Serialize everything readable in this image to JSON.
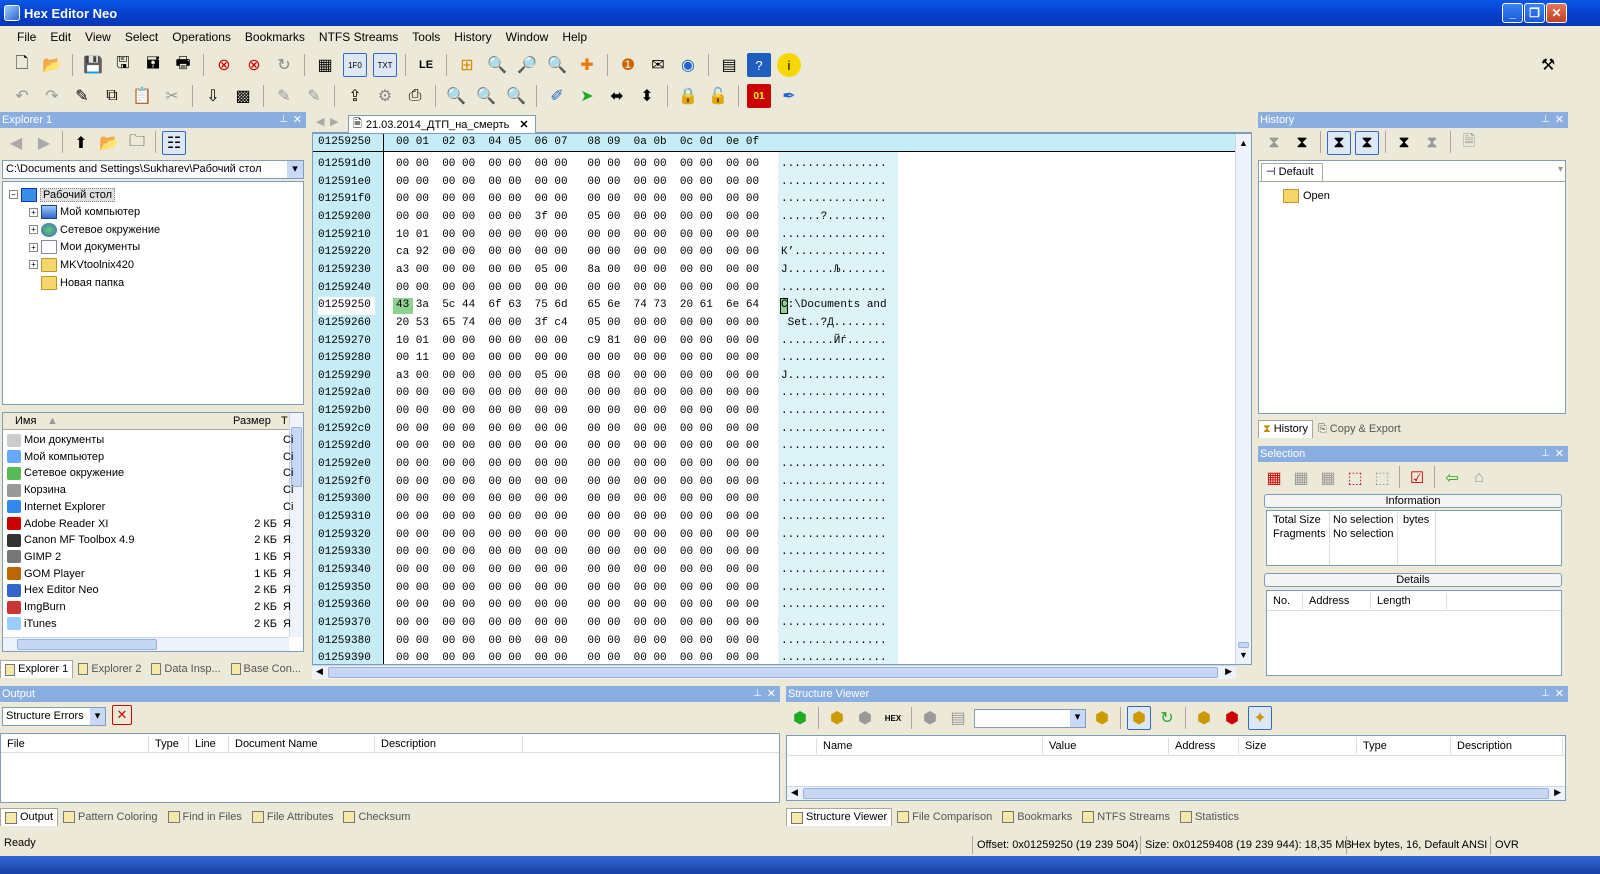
{
  "app": {
    "title": "Hex Editor Neo"
  },
  "menu": [
    "File",
    "Edit",
    "View",
    "Select",
    "Operations",
    "Bookmarks",
    "NTFS Streams",
    "Tools",
    "History",
    "Window",
    "Help"
  ],
  "explorer": {
    "title": "Explorer 1",
    "path": "C:\\Documents and Settings\\Sukharev\\Рабочий стол",
    "tree": [
      {
        "label": "Рабочий стол",
        "icon": "desktop-icon",
        "level": 0,
        "expander": "−",
        "selected": true
      },
      {
        "label": "Мой компьютер",
        "icon": "computer-icon",
        "level": 1,
        "expander": "+"
      },
      {
        "label": "Сетевое окружение",
        "icon": "network-icon",
        "level": 1,
        "expander": "+"
      },
      {
        "label": "Мои документы",
        "icon": "documents-icon",
        "level": 1,
        "expander": "+"
      },
      {
        "label": "MKVtoolnix420",
        "icon": "folder-icon",
        "level": 1,
        "expander": "+"
      },
      {
        "label": "Новая папка",
        "icon": "folder-icon",
        "level": 1,
        "expander": ""
      }
    ],
    "list_headers": {
      "name": "Имя",
      "size": "Размер",
      "type": "Т"
    },
    "list": [
      {
        "name": "Мои документы",
        "size": "",
        "type": "Сі"
      },
      {
        "name": "Мой компьютер",
        "size": "",
        "type": "Сі"
      },
      {
        "name": "Сетевое окружение",
        "size": "",
        "type": "Сі"
      },
      {
        "name": "Корзина",
        "size": "",
        "type": "Сі"
      },
      {
        "name": "Internet Explorer",
        "size": "",
        "type": "Сі"
      },
      {
        "name": "Adobe Reader XI",
        "size": "2 КБ",
        "type": "Я"
      },
      {
        "name": "Canon MF Toolbox 4.9",
        "size": "2 КБ",
        "type": "Я"
      },
      {
        "name": "GIMP 2",
        "size": "1 КБ",
        "type": "Я"
      },
      {
        "name": "GOM Player",
        "size": "1 КБ",
        "type": "Я"
      },
      {
        "name": "Hex Editor Neo",
        "size": "2 КБ",
        "type": "Я"
      },
      {
        "name": "ImgBurn",
        "size": "2 КБ",
        "type": "Я"
      },
      {
        "name": "iTunes",
        "size": "2 КБ",
        "type": "Я"
      }
    ],
    "tabs": [
      "Explorer 1",
      "Explorer 2",
      "Data Insp...",
      "Base Con..."
    ]
  },
  "editor": {
    "tab": "21.03.2014_ДТП_на_смерть",
    "header_offset": "01259250",
    "header_cols": "00 01  02 03  04 05  06 07   08 09  0a 0b  0c 0d  0e 0f",
    "rows": [
      {
        "off": "012591d0",
        "hex": "00 00  00 00  00 00  00 00   00 00  00 00  00 00  00 00",
        "asc": "................"
      },
      {
        "off": "012591e0",
        "hex": "00 00  00 00  00 00  00 00   00 00  00 00  00 00  00 00",
        "asc": "................"
      },
      {
        "off": "012591f0",
        "hex": "00 00  00 00  00 00  00 00   00 00  00 00  00 00  00 00",
        "asc": "................"
      },
      {
        "off": "01259200",
        "hex": "00 00  00 00  00 00  3f 00   05 00  00 00  00 00  00 00",
        "asc": "......?........."
      },
      {
        "off": "01259210",
        "hex": "10 01  00 00  00 00  00 00   00 00  00 00  00 00  00 00",
        "asc": "................"
      },
      {
        "off": "01259220",
        "hex": "ca 92  00 00  00 00  00 00   00 00  00 00  00 00  00 00",
        "asc": "К’.............."
      },
      {
        "off": "01259230",
        "hex": "a3 00  00 00  00 00  05 00   8a 00  00 00  00 00  00 00",
        "asc": "Ј.......Љ......."
      },
      {
        "off": "01259240",
        "hex": "00 00  00 00  00 00  00 00   00 00  00 00  00 00  00 00",
        "asc": "................"
      },
      {
        "off": "01259250",
        "hex": "43 3a  5c 44  6f 63  75 6d   65 6e  74 73  20 61  6e 64",
        "asc": "C:\\Documents and",
        "cursor": true
      },
      {
        "off": "01259260",
        "hex": "20 53  65 74  00 00  3f c4   05 00  00 00  00 00  00 00",
        "asc": " Set..?Д........"
      },
      {
        "off": "01259270",
        "hex": "10 01  00 00  00 00  00 00   c9 81  00 00  00 00  00 00",
        "asc": "........Йѓ......"
      },
      {
        "off": "01259280",
        "hex": "00 11  00 00  00 00  00 00   00 00  00 00  00 00  00 00",
        "asc": "................"
      },
      {
        "off": "01259290",
        "hex": "a3 00  00 00  00 00  05 00   08 00  00 00  00 00  00 00",
        "asc": "Ј..............."
      },
      {
        "off": "012592a0",
        "hex": "00 00  00 00  00 00  00 00   00 00  00 00  00 00  00 00",
        "asc": "................"
      },
      {
        "off": "012592b0",
        "hex": "00 00  00 00  00 00  00 00   00 00  00 00  00 00  00 00",
        "asc": "................"
      },
      {
        "off": "012592c0",
        "hex": "00 00  00 00  00 00  00 00   00 00  00 00  00 00  00 00",
        "asc": "................"
      },
      {
        "off": "012592d0",
        "hex": "00 00  00 00  00 00  00 00   00 00  00 00  00 00  00 00",
        "asc": "................"
      },
      {
        "off": "012592e0",
        "hex": "00 00  00 00  00 00  00 00   00 00  00 00  00 00  00 00",
        "asc": "................"
      },
      {
        "off": "012592f0",
        "hex": "00 00  00 00  00 00  00 00   00 00  00 00  00 00  00 00",
        "asc": "................"
      },
      {
        "off": "01259300",
        "hex": "00 00  00 00  00 00  00 00   00 00  00 00  00 00  00 00",
        "asc": "................"
      },
      {
        "off": "01259310",
        "hex": "00 00  00 00  00 00  00 00   00 00  00 00  00 00  00 00",
        "asc": "................"
      },
      {
        "off": "01259320",
        "hex": "00 00  00 00  00 00  00 00   00 00  00 00  00 00  00 00",
        "asc": "................"
      },
      {
        "off": "01259330",
        "hex": "00 00  00 00  00 00  00 00   00 00  00 00  00 00  00 00",
        "asc": "................"
      },
      {
        "off": "01259340",
        "hex": "00 00  00 00  00 00  00 00   00 00  00 00  00 00  00 00",
        "asc": "................"
      },
      {
        "off": "01259350",
        "hex": "00 00  00 00  00 00  00 00   00 00  00 00  00 00  00 00",
        "asc": "................"
      },
      {
        "off": "01259360",
        "hex": "00 00  00 00  00 00  00 00   00 00  00 00  00 00  00 00",
        "asc": "................"
      },
      {
        "off": "01259370",
        "hex": "00 00  00 00  00 00  00 00   00 00  00 00  00 00  00 00",
        "asc": "................"
      },
      {
        "off": "01259380",
        "hex": "00 00  00 00  00 00  00 00   00 00  00 00  00 00  00 00",
        "asc": "................"
      },
      {
        "off": "01259390",
        "hex": "00 00  00 00  00 00  00 00   00 00  00 00  00 00  00 00",
        "asc": "................"
      }
    ]
  },
  "history": {
    "title": "History",
    "default_tab": "Default",
    "item": "Open",
    "tabs": [
      "History",
      "Copy & Export"
    ]
  },
  "selection": {
    "title": "Selection",
    "info_title": "Information",
    "total_size_label": "Total Size",
    "total_size_value": "No selection",
    "total_size_unit": "bytes",
    "fragments_label": "Fragments",
    "fragments_value": "No selection",
    "details_title": "Details",
    "details_cols": [
      "No.",
      "Address",
      "Length"
    ]
  },
  "output": {
    "title": "Output",
    "dropdown": "Structure Errors",
    "cols": [
      "File",
      "Type",
      "Line",
      "Document Name",
      "Description"
    ],
    "tabs": [
      "Output",
      "Pattern Coloring",
      "Find in Files",
      "File Attributes",
      "Checksum"
    ]
  },
  "structure": {
    "title": "Structure Viewer",
    "cols": [
      "Name",
      "Value",
      "Address",
      "Size",
      "Type",
      "Description"
    ],
    "tabs": [
      "Structure Viewer",
      "File Comparison",
      "Bookmarks",
      "NTFS Streams",
      "Statistics"
    ]
  },
  "status": {
    "ready": "Ready",
    "offset": "Offset: 0x01259250 (19 239 504)",
    "size": "Size: 0x01259408 (19 239 944): 18,35 MB",
    "mode": "Hex bytes, 16, Default ANSI",
    "ovr": "OVR"
  },
  "colors": {
    "title_bar": "#0542cf",
    "panel_title": "#8aaee0",
    "hex_offset_bg": "#c6ecf5",
    "cursor": "#8fd18f"
  }
}
